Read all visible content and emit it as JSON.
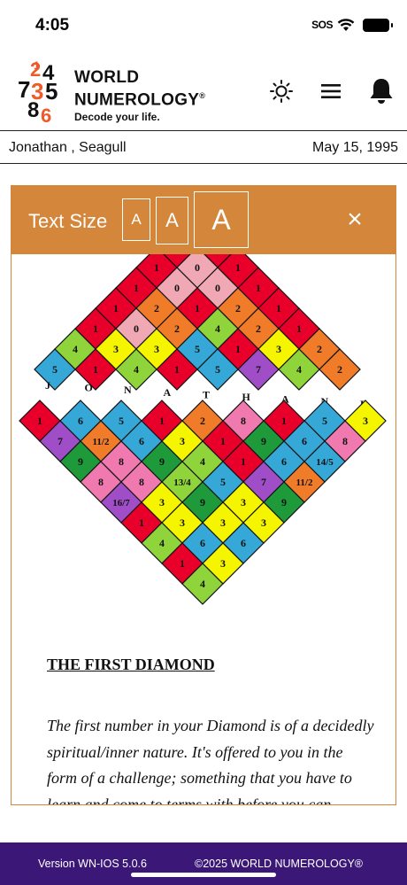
{
  "status_bar": {
    "time": "4:05",
    "sos": "SOS"
  },
  "brand": {
    "line1": "WORLD",
    "line2": "NUMEROLOGY",
    "registered": "®",
    "tagline": "Decode your life."
  },
  "header_icons": [
    "brightness-icon",
    "menu-icon",
    "bell-icon"
  ],
  "user": {
    "name": "Jonathan , Seagull",
    "birth_date": "May 15, 1995"
  },
  "text_size": {
    "label": "Text Size",
    "small": "A",
    "medium": "A",
    "large": "A",
    "close": "×"
  },
  "diamond": {
    "name_letters": [
      "J",
      "O",
      "N",
      "A",
      "T",
      "H",
      "A",
      "N",
      "L"
    ],
    "top_cells": [
      {
        "v": "1",
        "c": "#e8002a"
      },
      {
        "v": "1",
        "c": "#e8002a"
      },
      {
        "v": "1",
        "c": "#e8002a"
      },
      {
        "v": "0",
        "c": "#f0a8b4"
      },
      {
        "v": "1",
        "c": "#e8002a"
      },
      {
        "v": "1",
        "c": "#e8002a"
      },
      {
        "v": "0",
        "c": "#f0a8b4"
      },
      {
        "v": "0",
        "c": "#f0a8b4"
      },
      {
        "v": "1",
        "c": "#e8002a"
      },
      {
        "v": "1",
        "c": "#e8002a"
      },
      {
        "v": "2",
        "c": "#f07c2a"
      },
      {
        "v": "1",
        "c": "#e8002a"
      },
      {
        "v": "2",
        "c": "#f07c2a"
      },
      {
        "v": "1",
        "c": "#e8002a"
      },
      {
        "v": "1",
        "c": "#e8002a"
      },
      {
        "v": "0",
        "c": "#f0a8b4"
      },
      {
        "v": "2",
        "c": "#f07c2a"
      },
      {
        "v": "4",
        "c": "#8fd43a"
      },
      {
        "v": "2",
        "c": "#f07c2a"
      },
      {
        "v": "1",
        "c": "#e8002a"
      },
      {
        "v": "4",
        "c": "#8fd43a"
      },
      {
        "v": "3",
        "c": "#f5f500"
      },
      {
        "v": "3",
        "c": "#f5f500"
      },
      {
        "v": "5",
        "c": "#35a8d8"
      },
      {
        "v": "1",
        "c": "#e8002a"
      },
      {
        "v": "3",
        "c": "#f5f500"
      },
      {
        "v": "2",
        "c": "#f07c2a"
      },
      {
        "v": "5",
        "c": "#35a8d8"
      },
      {
        "v": "1",
        "c": "#e8002a"
      },
      {
        "v": "4",
        "c": "#8fd43a"
      },
      {
        "v": "1",
        "c": "#e8002a"
      },
      {
        "v": "5",
        "c": "#35a8d8"
      },
      {
        "v": "7",
        "c": "#a04ec8"
      },
      {
        "v": "4",
        "c": "#8fd43a"
      },
      {
        "v": "2",
        "c": "#f07c2a"
      }
    ],
    "bottom_cells": [
      {
        "v": "1",
        "c": "#e8002a"
      },
      {
        "v": "6",
        "c": "#35a8d8"
      },
      {
        "v": "5",
        "c": "#35a8d8"
      },
      {
        "v": "1",
        "c": "#e8002a"
      },
      {
        "v": "2",
        "c": "#f07c2a"
      },
      {
        "v": "8",
        "c": "#f07ab0"
      },
      {
        "v": "1",
        "c": "#e8002a"
      },
      {
        "v": "5",
        "c": "#35a8d8"
      },
      {
        "v": "3",
        "c": "#f5f500"
      },
      {
        "v": "7",
        "c": "#a04ec8"
      },
      {
        "v": "11/2",
        "c": "#f07c2a"
      },
      {
        "v": "6",
        "c": "#35a8d8"
      },
      {
        "v": "3",
        "c": "#f5f500"
      },
      {
        "v": "1",
        "c": "#e8002a"
      },
      {
        "v": "9",
        "c": "#1e9a3a"
      },
      {
        "v": "6",
        "c": "#35a8d8"
      },
      {
        "v": "8",
        "c": "#f07ab0"
      },
      {
        "v": "9",
        "c": "#1e9a3a"
      },
      {
        "v": "8",
        "c": "#f07ab0"
      },
      {
        "v": "9",
        "c": "#1e9a3a"
      },
      {
        "v": "4",
        "c": "#8fd43a"
      },
      {
        "v": "1",
        "c": "#e8002a"
      },
      {
        "v": "6",
        "c": "#35a8d8"
      },
      {
        "v": "14/5",
        "c": "#35a8d8"
      },
      {
        "v": "8",
        "c": "#f07ab0"
      },
      {
        "v": "8",
        "c": "#f07ab0"
      },
      {
        "v": "13/4",
        "c": "#8fd43a"
      },
      {
        "v": "5",
        "c": "#35a8d8"
      },
      {
        "v": "7",
        "c": "#a04ec8"
      },
      {
        "v": "11/2",
        "c": "#f07c2a"
      },
      {
        "v": "16/7",
        "c": "#a04ec8"
      },
      {
        "v": "3",
        "c": "#f5f500"
      },
      {
        "v": "9",
        "c": "#1e9a3a"
      },
      {
        "v": "3",
        "c": "#f5f500"
      },
      {
        "v": "9",
        "c": "#1e9a3a"
      },
      {
        "v": "1",
        "c": "#e8002a"
      },
      {
        "v": "3",
        "c": "#f5f500"
      },
      {
        "v": "3",
        "c": "#f5f500"
      },
      {
        "v": "3",
        "c": "#f5f500"
      },
      {
        "v": "4",
        "c": "#8fd43a"
      },
      {
        "v": "6",
        "c": "#35a8d8"
      },
      {
        "v": "6",
        "c": "#35a8d8"
      },
      {
        "v": "1",
        "c": "#e8002a"
      },
      {
        "v": "3",
        "c": "#f5f500"
      },
      {
        "v": "4",
        "c": "#8fd43a"
      }
    ]
  },
  "article": {
    "heading": "THE FIRST DIAMOND",
    "body": "The first number in your Diamond is of a decidedly spiritual/inner nature. It's offered to you in the form of a challenge; something that you have to learn and come to terms with before you can"
  },
  "footer": {
    "version": "Version WN-IOS 5.0.6",
    "copyright": "©2025 WORLD NUMEROLOGY®"
  },
  "colors": {
    "accent": "#d4863a",
    "footer_bg": "#3b1878",
    "logo_orange": "#f05a28"
  }
}
